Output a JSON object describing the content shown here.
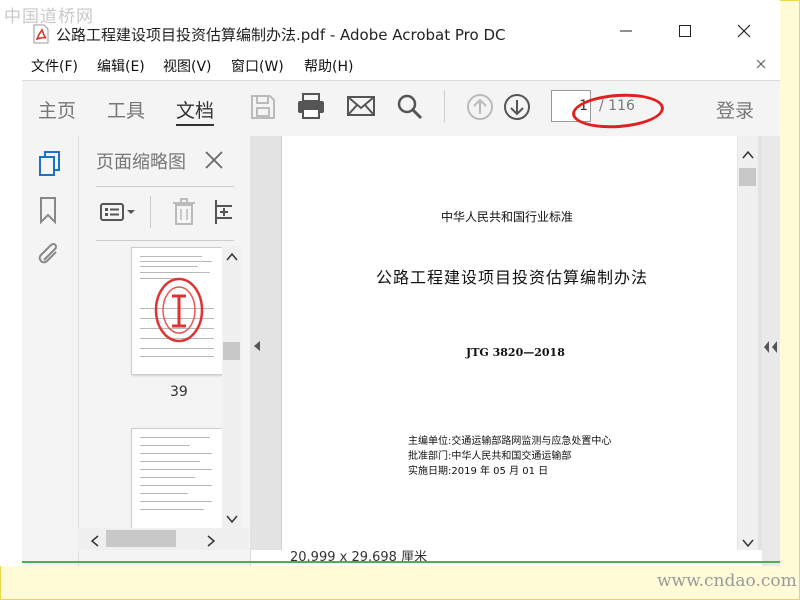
{
  "watermarks": {
    "top": "中国道桥网",
    "bottom": "www.cndao.com"
  },
  "window": {
    "title": "公路工程建设项目投资估算编制办法.pdf - Adobe Acrobat Pro DC"
  },
  "menu": [
    "文件(F)",
    "编辑(E)",
    "视图(V)",
    "窗口(W)",
    "帮助(H)"
  ],
  "tabs": {
    "home": "主页",
    "tools": "工具",
    "document": "文档"
  },
  "toolbar": {
    "page_value": "1",
    "page_total": "/ 116",
    "login": "登录"
  },
  "thumbnails": {
    "title": "页面缩略图",
    "page_label": "39"
  },
  "page_content": {
    "standard_type": "中华人民共和国行业标准",
    "doc_title": "公路工程建设项目投资估算编制办法",
    "code": "JTG  3820—2018",
    "editor": "主编单位:交通运输部路网监测与应急处置中心",
    "approver": "批准部门:中华人民共和国交通运输部",
    "date": "实施日期:2019 年 05 月 01 日"
  },
  "status": {
    "page_size": "20.999 x 29.698 厘米"
  },
  "colors": {
    "highlight_oval": "#e02020",
    "toolbar_bg": "#f4f4f4",
    "pdf_icon": "#d93025"
  }
}
